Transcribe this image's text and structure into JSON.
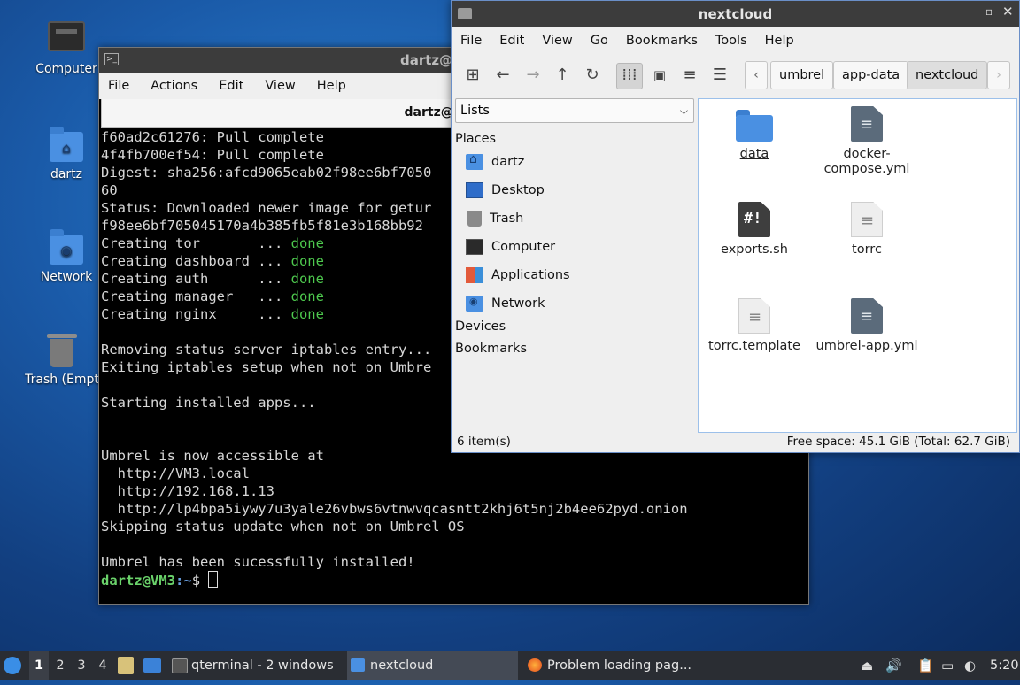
{
  "desktop": {
    "icons": [
      {
        "label": "Computer",
        "icon": "computer-icon"
      },
      {
        "label": "dartz",
        "icon": "home-folder-icon"
      },
      {
        "label": "Network",
        "icon": "network-folder-icon"
      },
      {
        "label": "Trash (Empt",
        "icon": "trash-icon"
      }
    ]
  },
  "terminal": {
    "title": "dartz@",
    "menu": [
      "File",
      "Actions",
      "Edit",
      "View",
      "Help"
    ],
    "tab": "dartz@VM3: ~",
    "lines": [
      "f60ad2c61276: Pull complete",
      "4f4fb700ef54: Pull complete",
      "Digest: sha256:afcd9065eab02f98ee6bf7050",
      "60",
      "Status: Downloaded newer image for getur",
      "f98ee6bf705045170a4b385fb5f81e3b168bb92",
      "",
      "",
      "",
      "",
      "",
      "",
      "Removing status server iptables entry...",
      "Exiting iptables setup when not on Umbre",
      "",
      "Starting installed apps...",
      "",
      "",
      "Umbrel is now accessible at",
      "  http://VM3.local",
      "  http://192.168.1.13",
      "  http://lp4bpa5iywy7u3yale26vbws6vtnwvqcasntt2khj6t5nj2b4ee62pyd.onion",
      "Skipping status update when not on Umbrel OS",
      "",
      "Umbrel has been sucessfully installed!"
    ],
    "creating": [
      {
        "text": "Creating tor       ... ",
        "status": "done"
      },
      {
        "text": "Creating dashboard ... ",
        "status": "done"
      },
      {
        "text": "Creating auth      ... ",
        "status": "done"
      },
      {
        "text": "Creating manager   ... ",
        "status": "done"
      },
      {
        "text": "Creating nginx     ... ",
        "status": "done"
      }
    ],
    "prompt": {
      "user": "dartz@VM3",
      "sep": ":",
      "path": "~",
      "symbol": "$ "
    }
  },
  "filemanager": {
    "title": "nextcloud",
    "menu": [
      "File",
      "Edit",
      "View",
      "Go",
      "Bookmarks",
      "Tools",
      "Help"
    ],
    "breadcrumb": [
      "umbrel",
      "app-data",
      "nextcloud"
    ],
    "side_view": "Lists",
    "places_header": "Places",
    "places": [
      {
        "label": "dartz",
        "icon": "home-folder-icon"
      },
      {
        "label": "Desktop",
        "icon": "desktop-icon"
      },
      {
        "label": "Trash",
        "icon": "trash-icon"
      },
      {
        "label": "Computer",
        "icon": "computer-icon"
      },
      {
        "label": "Applications",
        "icon": "applications-icon"
      },
      {
        "label": "Network",
        "icon": "network-folder-icon"
      }
    ],
    "devices_header": "Devices",
    "bookmarks_header": "Bookmarks",
    "files": [
      {
        "name": "data",
        "type": "folder"
      },
      {
        "name": "docker-\ncompose.yml",
        "type": "yaml"
      },
      {
        "name": "exports.sh",
        "type": "script"
      },
      {
        "name": "torrc",
        "type": "text"
      },
      {
        "name": "torrc.template",
        "type": "text"
      },
      {
        "name": "umbrel-app.yml",
        "type": "yaml"
      }
    ],
    "status_left": "6 item(s)",
    "status_right": "Free space: 45.1 GiB (Total: 62.7 GiB)"
  },
  "taskbar": {
    "workspaces": [
      "1",
      "2",
      "3",
      "4"
    ],
    "tasks": [
      {
        "label": "qterminal - 2 windows"
      },
      {
        "label": "nextcloud"
      },
      {
        "label": "Problem loading pag..."
      }
    ],
    "clock": "5:20"
  }
}
